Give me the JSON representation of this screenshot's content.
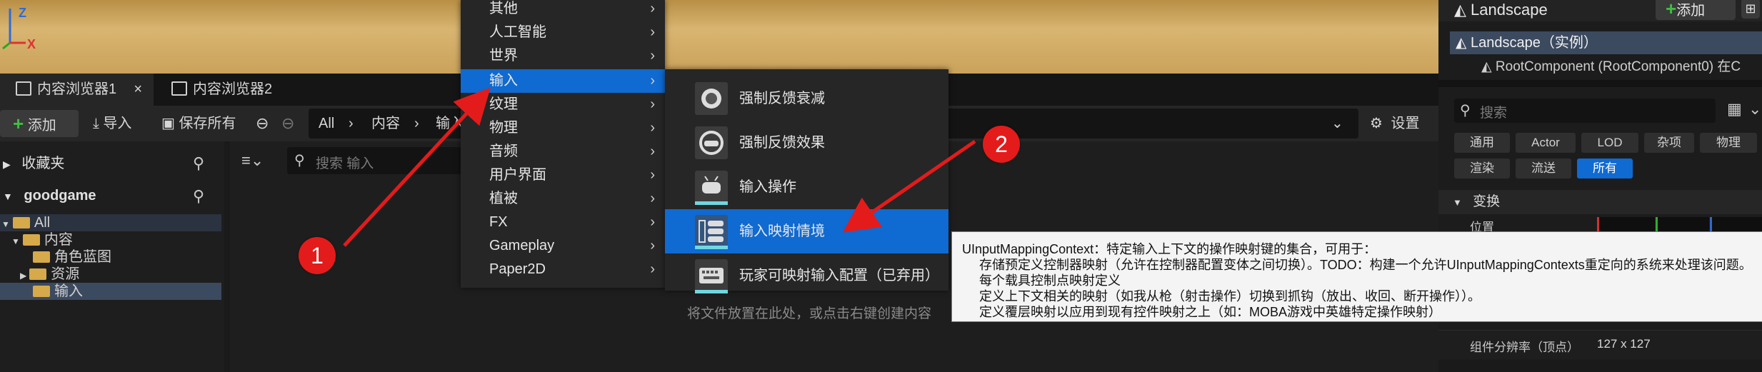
{
  "viewport": {
    "axis_z": "Z",
    "axis_x": "X"
  },
  "tabs": [
    {
      "label": "内容浏览器1",
      "close": "×"
    },
    {
      "label": "内容浏览器2"
    }
  ],
  "toolbar": {
    "add_label": "添加",
    "import_label": "导入",
    "save_all_label": "保存所有",
    "breadcrumb": [
      "All",
      "内容",
      "输入"
    ],
    "settings_label": "设置"
  },
  "left_panel": {
    "favorites": "收藏夹",
    "project": "goodgame",
    "tree": [
      "All",
      "内容",
      "角色蓝图",
      "资源",
      "输入"
    ]
  },
  "main_panel": {
    "search_placeholder": "搜索 输入",
    "hint_text": "将文件放置在此处，或点击右键创建内容"
  },
  "context_menu": {
    "items": [
      "其他",
      "人工智能",
      "世界",
      "输入",
      "纹理",
      "物理",
      "音频",
      "用户界面",
      "植被",
      "FX",
      "Gameplay",
      "Paper2D"
    ],
    "selected": "输入"
  },
  "submenu": {
    "items": [
      "强制反馈衰减",
      "强制反馈效果",
      "输入操作",
      "输入映射情境",
      "玩家可映射输入配置（已弃用）"
    ],
    "selected": "输入映射情境"
  },
  "tooltip": {
    "lines": [
      "UInputMappingContext：特定输入上下文的操作映射键的集合，可用于：",
      "存储预定义控制器映射（允许在控制器配置变体之间切换）。TODO：构建一个允许UInputMappingContexts重定向的系统来处理该问题。",
      "每个载具控制点映射定义",
      "定义上下文相关的映射（如我从枪（射击操作）切换到抓钩（放出、收回、断开操作））。",
      "定义覆层映射以应用到现有控件映射之上（如：MOBA游戏中英雄特定操作映射）"
    ]
  },
  "annotations": {
    "badge1": "1",
    "badge2": "2",
    "arrow_color": "#e41b1b"
  },
  "right_panel": {
    "title": "Landscape",
    "add_label": "添加",
    "instance_label": "Landscape（实例）",
    "root_component": "RootComponent (RootComponent0)",
    "root_suffix": "在C",
    "search_placeholder": "搜索",
    "categories_row1": [
      "通用",
      "Actor",
      "LOD",
      "杂项",
      "物理"
    ],
    "categories_row2": [
      "渲染",
      "流送",
      "所有"
    ],
    "selected_category": "所有",
    "section_transform": "变换",
    "location_label": "位置",
    "component_res_label": "组件分辨率（顶点）",
    "component_res_value": "127 x 127"
  },
  "colors": {
    "accent": "#0f6ad1",
    "badge": "#e41b1b"
  }
}
